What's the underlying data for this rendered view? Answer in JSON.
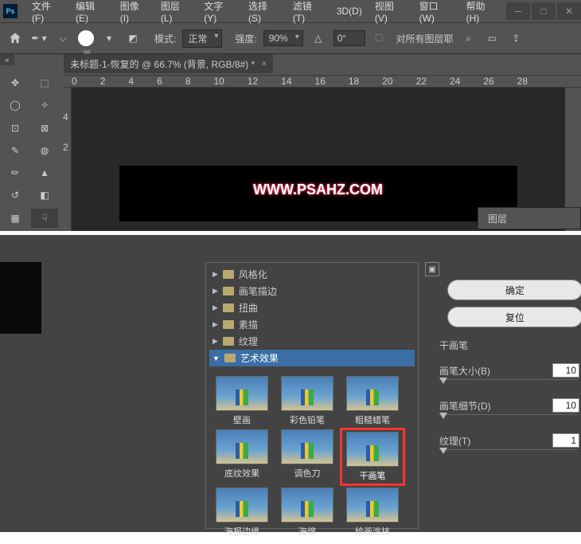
{
  "menu": {
    "file": "文件(F)",
    "edit": "编辑(E)",
    "image": "图像(I)",
    "layer": "图层(L)",
    "type": "文字(Y)",
    "select": "选择(S)",
    "filter": "滤镜(T)",
    "threeD": "3D(D)",
    "view": "视图(V)",
    "window": "窗口(W)",
    "help": "帮助(H)"
  },
  "optbar": {
    "brush_size": "35",
    "mode_label": "模式:",
    "mode_value": "正常",
    "strength_label": "强度:",
    "strength_value": "90%",
    "angle_value": "0°",
    "all_layers": "对所有图层耶"
  },
  "doc": {
    "title": "未标题-1-恢复的 @ 66.7% (背景, RGB/8#) *"
  },
  "ruler_h": [
    "0",
    "2",
    "4",
    "6",
    "8",
    "10",
    "12",
    "14",
    "16",
    "18",
    "20",
    "22",
    "24",
    "26",
    "28"
  ],
  "ruler_v": [
    "4",
    "2"
  ],
  "watermark": "WWW.PSAHZ.COM",
  "layers_panel": "图层",
  "tree": {
    "stylize": "风格化",
    "brushstrokes": "画笔描边",
    "distort": "扭曲",
    "sketch": "素描",
    "texture": "纹理",
    "artistic": "艺术效果"
  },
  "thumbs": {
    "fresco": "壁画",
    "colored_pencil": "彩色铅笔",
    "rough_pastels": "粗糙蜡笔",
    "underpainting": "底纹效果",
    "palette_knife": "调色刀",
    "dry_brush": "干画笔",
    "poster_edges": "海报边缘",
    "sponge": "海绵",
    "paint_daubs": "绘画涂抹"
  },
  "side": {
    "ok": "确定",
    "reset": "复位",
    "filter_name": "干画笔",
    "p1": "画笔大小(B)",
    "p1v": "10",
    "p2": "画笔细节(D)",
    "p2v": "10",
    "p3": "纹理(T)",
    "p3v": "1"
  }
}
